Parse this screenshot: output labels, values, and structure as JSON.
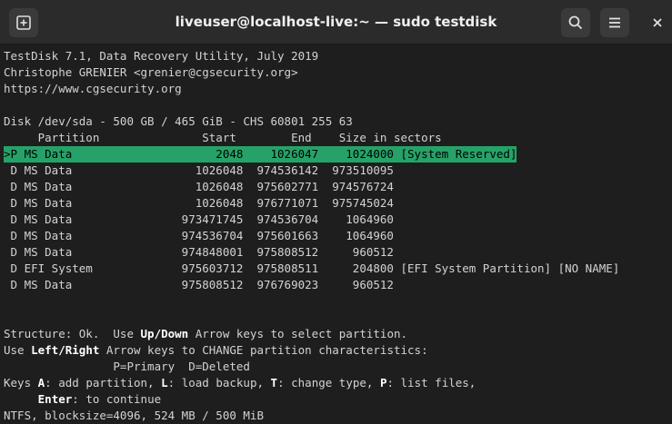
{
  "window": {
    "title": "liveuser@localhost-live:~ — sudo testdisk"
  },
  "icons": {
    "new_tab": "new-tab-icon",
    "search": "search-icon",
    "menu": "hamburger-menu-icon",
    "close": "close-icon"
  },
  "colors": {
    "selection_bg": "#26a269",
    "terminal_bg": "#1e1e1e",
    "terminal_fg": "#d3d3d3"
  },
  "terminal": {
    "header": [
      "TestDisk 7.1, Data Recovery Utility, July 2019",
      "Christophe GRENIER <grenier@cgsecurity.org>",
      "https://www.cgsecurity.org"
    ],
    "disk_line": "Disk /dev/sda - 500 GB / 465 GiB - CHS 60801 255 63",
    "columns_line": "     Partition               Start        End    Size in sectors",
    "rows": [
      ">P MS Data                     2048    1026047    1024000 [System Reserved]",
      " D MS Data                  1026048  974536142  973510095",
      " D MS Data                  1026048  975602771  974576724",
      " D MS Data                  1026048  976771071  975745024",
      " D MS Data                973471745  974536704    1064960",
      " D MS Data                974536704  975601663    1064960",
      " D MS Data                974848001  975808512     960512",
      " D EFI System             975603712  975808511     204800 [EFI System Partition] [NO NAME]",
      " D MS Data                975808512  976769023     960512"
    ],
    "footer": {
      "l1a": "Structure: Ok.  Use ",
      "l1b": "Up/Down",
      "l1c": " Arrow keys to select partition.",
      "l2a": "Use ",
      "l2b": "Left/Right",
      "l2c": " Arrow keys to CHANGE partition characteristics:",
      "l3": "                P=Primary  D=Deleted",
      "l4a": "Keys ",
      "l4b": "A",
      "l4c": ": add partition, ",
      "l4d": "L",
      "l4e": ": load backup, ",
      "l4f": "T",
      "l4g": ": change type, ",
      "l4h": "P",
      "l4i": ": list files,",
      "l5a": "     ",
      "l5b": "Enter",
      "l5c": ": to continue",
      "l6": "NTFS, blocksize=4096, 524 MB / 500 MiB"
    }
  }
}
